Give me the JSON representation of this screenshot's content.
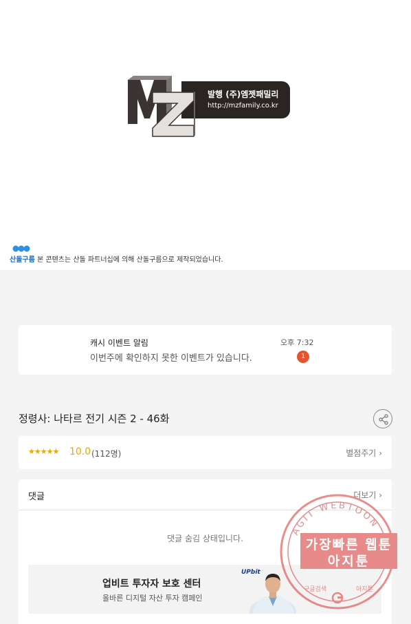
{
  "publisher": {
    "logo_letters": "MZ",
    "line1": "발행 (주)엠젯패밀리",
    "line2": "http://mzfamily.co.kr"
  },
  "notice": {
    "brand": "산돌구름",
    "text": " 본 콘텐츠는 산돌 파트너십에 의해 산돌구름으로 제작되었습니다."
  },
  "event_notification": {
    "title": "캐시 이벤트 알림",
    "time": "오후 7:32",
    "message": "이번주에 확인하지 못한 이벤트가 있습니다.",
    "badge_count": "1"
  },
  "episode": {
    "title": "정령사: 나타르 전기 시즌 2 - 46화"
  },
  "rating": {
    "stars": "★★★★★",
    "score": "10.0",
    "count": "(112명)",
    "rate_link": "별점주기"
  },
  "comments": {
    "title": "댓글",
    "more": "더보기",
    "hidden_notice": "댓글 숨김 상태입니다."
  },
  "ad": {
    "title": "업비트 투자자 보호 센터",
    "subtitle": "올바른 디지털 자산 투자 캠페인",
    "brand": "UPbit"
  },
  "watermark": {
    "arc_text": "AGIT WEBTOON",
    "line1": "가장빠른 웹툰",
    "line2": "아지툰",
    "bottom_left": "구글검색",
    "bottom_right": "아지툰"
  },
  "colors": {
    "accent_star": "#f0a500",
    "badge": "#e5542f",
    "watermark": "#e06060"
  }
}
